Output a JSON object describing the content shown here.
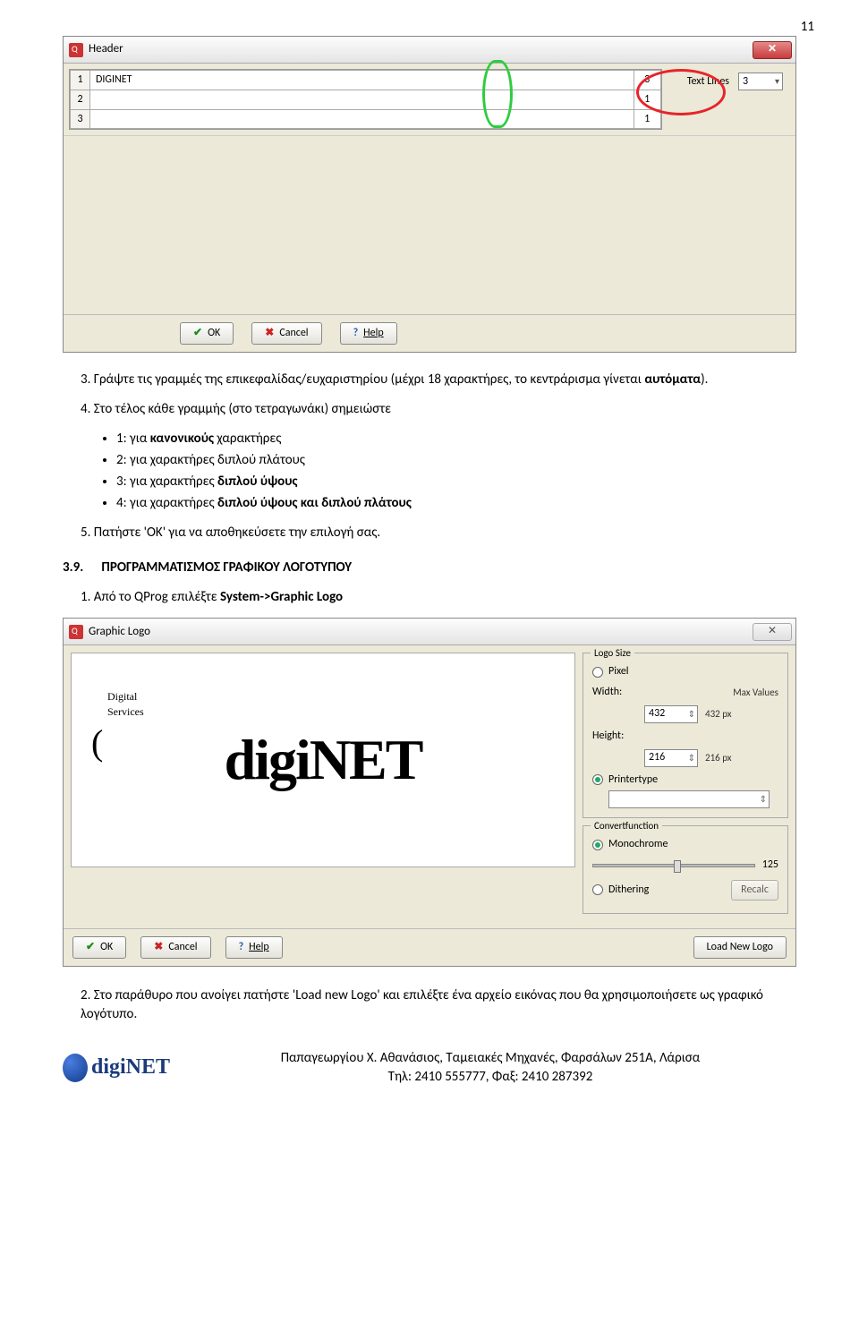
{
  "page_number": "11",
  "header_dialog": {
    "title": "Header",
    "rows": [
      {
        "num": "1",
        "text": "DIGINET",
        "col2": "3"
      },
      {
        "num": "2",
        "text": "",
        "col2": "1"
      },
      {
        "num": "3",
        "text": "",
        "col2": "1"
      }
    ],
    "text_lines_label": "Text Lines",
    "text_lines_value": "3",
    "buttons": {
      "ok": "OK",
      "cancel": "Cancel",
      "help": "Help"
    }
  },
  "instructions": {
    "step3_prefix": "3. Γράψτε τις γραμμές της επικεφαλίδας/ευχαριστηρίου (μέχρι 18 χαρακτήρες, το κεντράρισμα γίνεται ",
    "step3_bold": "αυτόματα",
    "step3_suffix": ").",
    "step4": "4. Στο τέλος κάθε γραμμής (στο τετραγωνάκι) σημειώστε",
    "bullets": [
      {
        "pre": "1: για ",
        "bold": "κανονικούς",
        "post": " χαρακτήρες"
      },
      {
        "pre": "2: για χαρακτήρες διπλού πλάτους",
        "bold": "",
        "post": ""
      },
      {
        "pre": "3: για χαρακτήρες ",
        "bold": "διπλού ύψους",
        "post": ""
      },
      {
        "pre": "4: για χαρακτήρες ",
        "bold": "διπλού ύψους και διπλού πλάτους",
        "post": ""
      }
    ],
    "step5": "5. Πατήστε 'OK' για να αποθηκεύσετε την επιλογή σας."
  },
  "section_heading": {
    "num": "3.9.",
    "title": "ΠΡΟΓΡΑΜΜΑΤΙΣΜΟΣ ΓΡΑΦΙΚΟΥ ΛΟΓΟΤΥΠΟΥ"
  },
  "section_step1": {
    "pre": "1. Από το QProg επιλέξτε ",
    "bold": "System->Graphic Logo"
  },
  "graphic_dialog": {
    "title": "Graphic Logo",
    "logo_text": "digiNET",
    "logo_small_1": "Digital",
    "logo_small_2": "Services",
    "logo_size_legend": "Logo Size",
    "pixel_label": "Pixel",
    "width_label": "Width:",
    "width_value": "432",
    "width_max": "432 px",
    "height_label": "Height:",
    "height_value": "216",
    "height_max": "216 px",
    "max_values_label": "Max Values",
    "printertype_label": "Printertype",
    "convert_legend": "Convertfunction",
    "monochrome_label": "Monochrome",
    "monochrome_value": "125",
    "dithering_label": "Dithering",
    "recalc": "Recalc",
    "load_new_logo": "Load New Logo",
    "buttons": {
      "ok": "OK",
      "cancel": "Cancel",
      "help": "Help"
    }
  },
  "section_step2": "2. Στο παράθυρο που ανοίγει πατήστε 'Load new Logo' και επιλέξτε ένα αρχείο εικόνας που θα χρησιμοποιήσετε ως γραφικό λογότυπο.",
  "footer": {
    "logo_text": "digiNET",
    "line1": "Παπαγεωργίου Χ. Αθανάσιος, Ταμειακές Μηχανές, Φαρσάλων 251Α, Λάρισα",
    "line2": "Τηλ: 2410 555777, Φαξ: 2410 287392"
  }
}
